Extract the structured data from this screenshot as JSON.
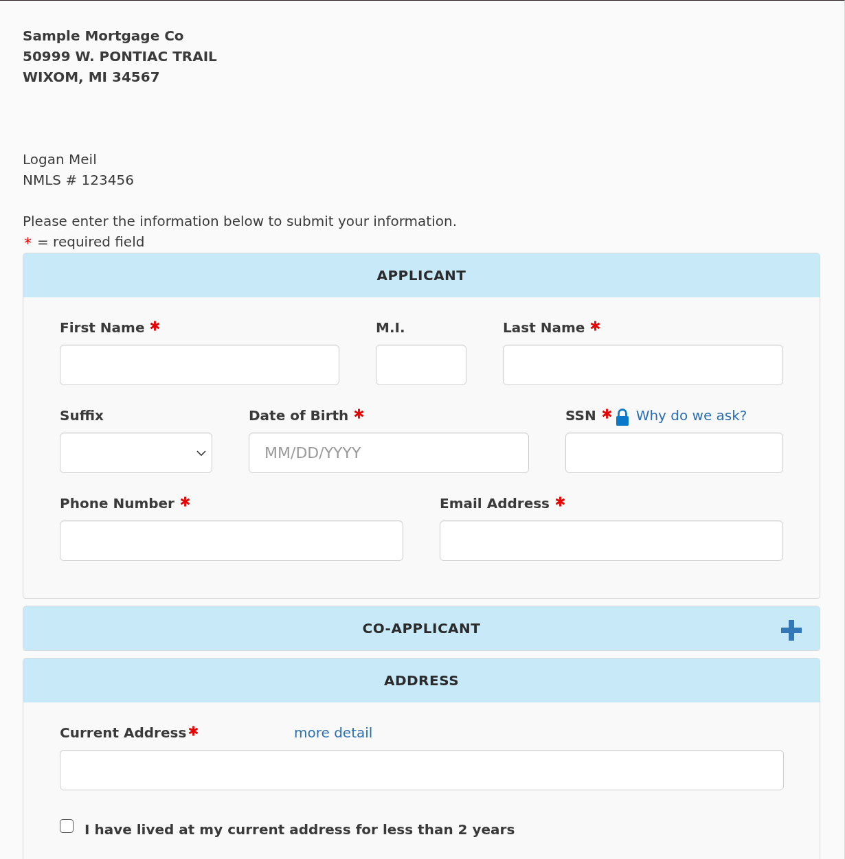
{
  "company": {
    "name": "Sample Mortgage Co",
    "address_lines": [
      "50999 W. PONTIAC TRAIL",
      "WIXOM, MI 34567"
    ]
  },
  "loan_officer": {
    "name": "Logan Meil",
    "nmls": "NMLS # 123456"
  },
  "instructions": "Please enter the information below to submit your information.",
  "required_legend": "= required field",
  "sections": [
    {
      "title": "APPLICANT",
      "expanded": true,
      "rows": [
        [
          {
            "kind": "text",
            "label": "First Name",
            "required": true
          },
          {
            "kind": "text",
            "label": "M.I.",
            "required": false
          },
          {
            "kind": "text",
            "label": "Last Name",
            "required": true
          }
        ],
        [
          {
            "kind": "select",
            "label": "Suffix",
            "required": false
          },
          {
            "kind": "text",
            "label": "Date of Birth",
            "required": true,
            "placeholder": "MM/DD/YYYY"
          },
          {
            "kind": "text",
            "label": "SSN",
            "required": true,
            "link": {
              "kind": "help",
              "text": "Why do we ask?"
            }
          }
        ],
        [
          {
            "kind": "text",
            "label": "Phone Number",
            "required": true
          },
          {
            "kind": "text",
            "label": "Email Address",
            "required": true
          }
        ]
      ]
    },
    {
      "title": "CO-APPLICANT",
      "expanded": false
    },
    {
      "title": "ADDRESS",
      "expanded": true,
      "rows": [
        [
          {
            "kind": "text",
            "label": "Current Address",
            "required": true,
            "link": {
              "kind": "detail",
              "text": "more detail"
            }
          }
        ],
        [
          {
            "kind": "checkbox",
            "label": "I have lived at my current address for less than 2 years",
            "checked": false
          }
        ]
      ]
    }
  ]
}
